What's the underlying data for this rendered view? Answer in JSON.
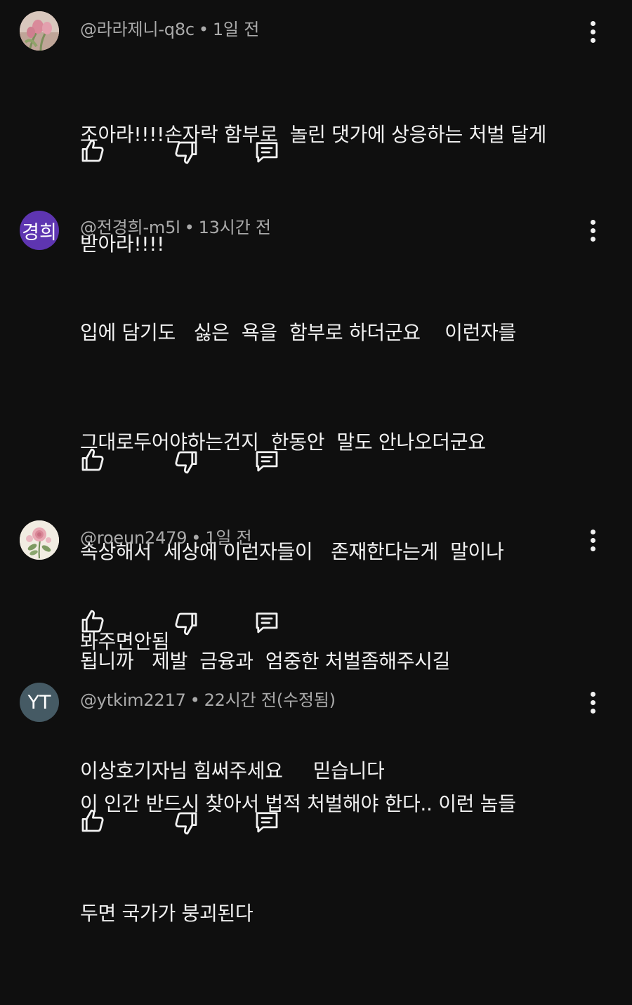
{
  "comments": [
    {
      "author": "@라라제니-q8c",
      "time": "1일 전",
      "avatar": {
        "type": "photo",
        "icon": "tulip-photo"
      },
      "lines": [
        "조아라!!!!손자락 함부로  놀린 댓가에 상응하는 처벌 달게",
        "받아라!!!!"
      ]
    },
    {
      "author": "@전경희-m5l",
      "time": "13시간 전",
      "avatar": {
        "type": "initials",
        "text": "경희",
        "color": "#5e35b1"
      },
      "lines": [
        "입에 담기도   싫은  욕을  함부로 하더군요    이런자를",
        "그대로두어야하는건지  한동안  말도 안나오더군요",
        "속상해서  세상에 이런자들이   존재한다는게  말이나",
        "됩니까   제발  금융과  엄중한 처벌좀해주시길",
        "이상호기자님 힘써주세요     믿습니다"
      ]
    },
    {
      "author": "@roeun2479",
      "time": "1일 전",
      "avatar": {
        "type": "photo",
        "icon": "rose-illustration"
      },
      "lines": [
        "봐주면안됨"
      ]
    },
    {
      "author": "@ytkim2217",
      "time": "22시간 전(수정됨)",
      "avatar": {
        "type": "initials",
        "text": "YT",
        "color": "#455a64"
      },
      "lines": [
        "이 인간 반드시 찾아서 법적 처벌해야 한다.. 이런 놈들",
        "두면 국가가 붕괴된다"
      ]
    }
  ],
  "actions": {
    "like_icon": "thumbs-up-icon",
    "dislike_icon": "thumbs-down-icon",
    "reply_icon": "reply-icon",
    "more_icon": "more-vert-icon"
  },
  "colors": {
    "background": "#0f0f0f",
    "text_primary": "#f1f1f1",
    "text_secondary": "#aaaaaa"
  }
}
